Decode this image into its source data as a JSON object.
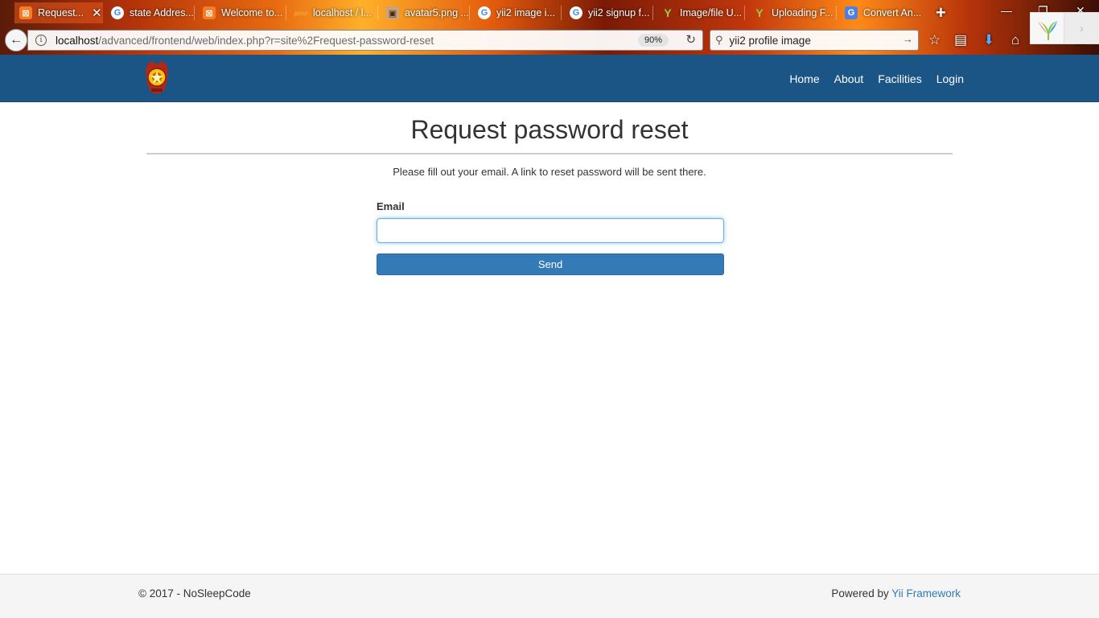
{
  "browser": {
    "tabs": [
      {
        "title": "Request...",
        "icon": "xampp-icon",
        "active": true
      },
      {
        "title": "state Addres...",
        "icon": "google-icon"
      },
      {
        "title": "Welcome to...",
        "icon": "xampp-icon"
      },
      {
        "title": "localhost / l...",
        "icon": "phpmyadmin-icon"
      },
      {
        "title": "avatar5.png ...",
        "icon": "image-icon"
      },
      {
        "title": "yii2 image i...",
        "icon": "google-icon"
      },
      {
        "title": "yii2 signup f...",
        "icon": "google-icon"
      },
      {
        "title": "Image/file U...",
        "icon": "yii-icon"
      },
      {
        "title": "Uploading F...",
        "icon": "yii-icon"
      },
      {
        "title": "Convert An...",
        "icon": "google-translate-icon"
      }
    ],
    "new_tab": "+",
    "url_host": "localhost",
    "url_rest": "/advanced/frontend/web/index.php?r=site%2Frequest-password-reset",
    "zoom": "90%",
    "search_value": "yii2 profile image"
  },
  "navbar": {
    "links": [
      "Home",
      "About",
      "Facilities",
      "Login"
    ]
  },
  "page": {
    "title": "Request password reset",
    "intro": "Please fill out your email. A link to reset password will be sent there.",
    "email_label": "Email",
    "email_value": "",
    "send_label": "Send"
  },
  "footer": {
    "copyright": "© 2017 - NoSleepCode",
    "powered_prefix": "Powered by ",
    "powered_link": "Yii Framework"
  },
  "colors": {
    "navbar": "#1b5585",
    "primary_button": "#337ab7",
    "link": "#337ab7"
  }
}
